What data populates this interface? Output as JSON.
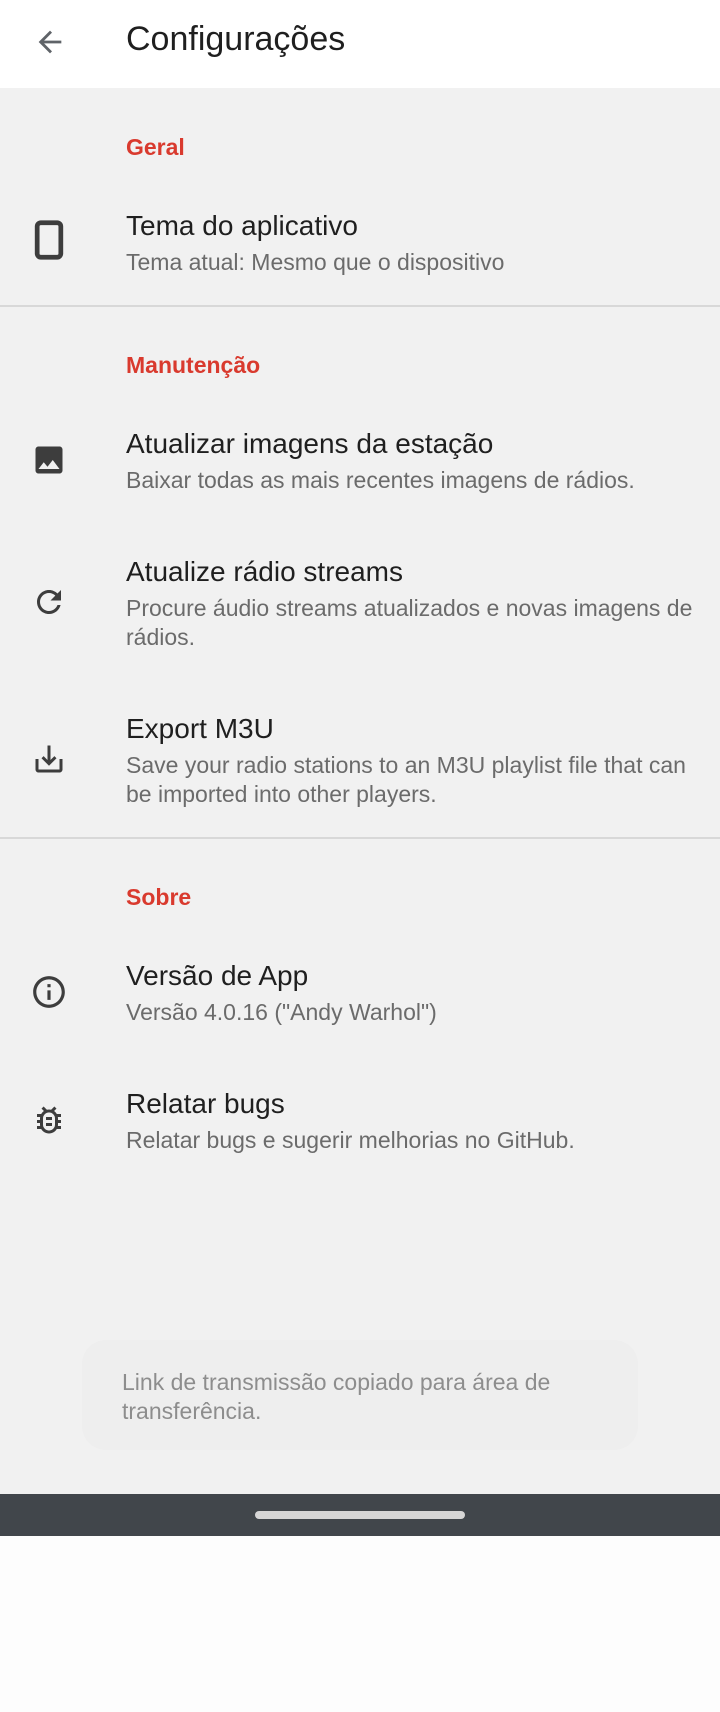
{
  "appbar": {
    "title": "Configurações",
    "back_icon": "arrow-back-icon"
  },
  "sections": {
    "general": {
      "title": "Geral",
      "items": [
        {
          "icon": "phone-icon",
          "title": "Tema do aplicativo",
          "subtitle": "Tema atual: Mesmo que o dispositivo"
        }
      ]
    },
    "maintenance": {
      "title": "Manutenção",
      "items": [
        {
          "icon": "image-icon",
          "title": "Atualizar imagens da estação",
          "subtitle": "Baixar todas as mais recentes imagens de rádios."
        },
        {
          "icon": "refresh-icon",
          "title": "Atualize rádio streams",
          "subtitle": "Procure áudio streams atualizados e novas imagens de rádios."
        },
        {
          "icon": "download-icon",
          "title": "Export M3U",
          "subtitle": "Save your radio stations to an M3U playlist file that can be imported into other players."
        }
      ]
    },
    "about": {
      "title": "Sobre",
      "items": [
        {
          "icon": "info-icon",
          "title": "Versão de App",
          "subtitle": "Versão 4.0.16 (\"Andy Warhol\")"
        },
        {
          "icon": "bug-icon",
          "title": "Relatar bugs",
          "subtitle": "Relatar bugs e sugerir melhorias no GitHub."
        }
      ]
    }
  },
  "snackbar": {
    "text": "Link de transmissão copiado para área de transferência."
  },
  "colors": {
    "accent": "#d93a2e",
    "background": "#f1f1f1",
    "navbar": "#41464b"
  }
}
